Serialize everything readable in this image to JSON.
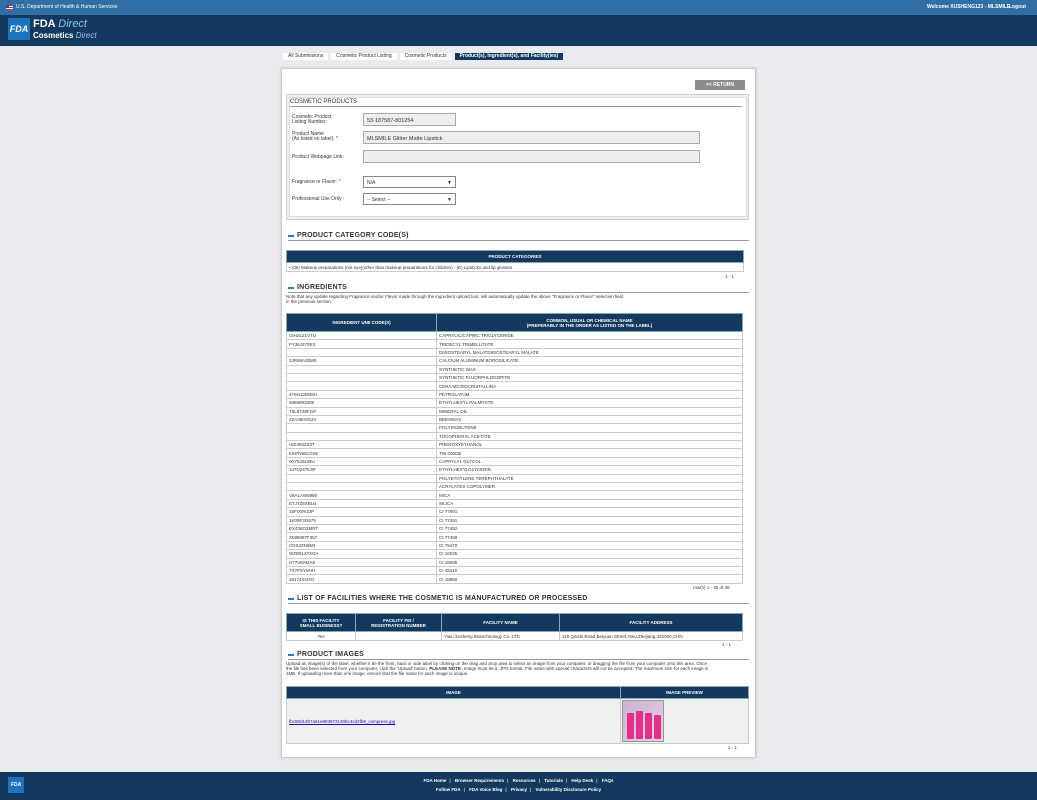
{
  "topbar": {
    "agency": "U.S. Department of Health & Human Services",
    "welcome": "Welcome XUSHENG123 - MLSMILE",
    "logout": "Logout"
  },
  "header": {
    "logo": "FDA",
    "brand_fda": "FDA",
    "brand_direct": "Direct",
    "brand_cosmetics": "Cosmetics",
    "brand_direct2": "Direct"
  },
  "breadcrumb": [
    "All Submissions",
    "Cosmetic Product Listing",
    "Cosmetic Products",
    "Product(s), Ingredient(s), and Facility(ies)"
  ],
  "return_button": "<< RETURN",
  "cosmetic_products": {
    "title": "COSMETIC PRODUCTS",
    "listing_label_1": "Cosmetic Product",
    "listing_label_2": "Listing Number:",
    "listing_value": "53-187587-801254",
    "name_label_1": "Product Name",
    "name_label_2": "(As listed on label):",
    "name_value": "MLSMILE Glitter Matte Lipstick",
    "webpage_label": "Product Webpage Link:",
    "webpage_value": "",
    "fragrance_label": "Fragrance or Flavor:",
    "fragrance_value": "N/A",
    "pro_label": "Professional Use Only :",
    "pro_value": "-- Select --",
    "required_mark": "*"
  },
  "category": {
    "title": "PRODUCT CATEGORY CODE(S)",
    "header": "PRODUCT CATEGORIES",
    "item": "(06) Makeup preparations (not eye)(other than makeup preparations for children) - (E) Lipsticks and lip glosses",
    "pager": "1 - 1"
  },
  "ingredients": {
    "title": "INGREDIENTS",
    "note_1": "Note that any update regarding Fragrance and/or Flavor made through the ingredient upload tool, will automatically update the above \"Fragrance or Flavor\" selection field",
    "note_2": "in the previous section.",
    "col1": "INGREDIENT UNII CODE(S)",
    "col2_1": "COMMON, USUAL OR CHEMICAL NAME",
    "col2_2": "(PREFERABLY IN THE ORDER AS LISTED ON THE LABEL)",
    "rows": [
      [
        "OIH2L21VTU",
        "CAPRYLIC/CAPRIC TRIGLYCERIDE"
      ],
      [
        "FY36J270ES",
        "TRIDECYL TRIMELLITATE"
      ],
      [
        "",
        "DIISOSTEARYL MALATDIISOSTEARYL MALATE"
      ],
      [
        "3JR68A35M0",
        "CALCIUM ALUMINUM BOROSILICATE"
      ],
      [
        "",
        "SYNTHETIC WAX"
      ],
      [
        "",
        "SYNTHETIC FLUORPHLOGOPITE"
      ],
      [
        "",
        "CERA MICROCRISTALLINA"
      ],
      [
        "4T6H12BN9U",
        "PETROLATUM"
      ],
      [
        "2865993309",
        "ETHYLHEXYL PALMITATE"
      ],
      [
        "T5L8T28FGP",
        "MINERAL OIL"
      ],
      [
        "2ZA36H0S2V",
        "BEESWAX"
      ],
      [
        "",
        "POLYISOBUTENE"
      ],
      [
        "",
        "TOCOPHERYL ACETATE"
      ],
      [
        "HIE492ZZ3T",
        "PHENOXYETHANOL"
      ],
      [
        "KM7N50LOS6",
        "TIN OXIDE"
      ],
      [
        "00YIU5438U",
        "CAPRYLYL GLYCOL"
      ],
      [
        "147D247K3P",
        "ETHYLHEXYLGLYCERIN"
      ],
      [
        "",
        "POLYETHYLENE TEREPHTHALATE"
      ],
      [
        "",
        "ACRYLATES COPOLYMER"
      ],
      [
        "V8A1AW0880",
        "MICA"
      ],
      [
        "ETJ7Z6XBU4",
        "SILICA"
      ],
      [
        "15FIX9V2JP",
        "CI 77891"
      ],
      [
        "1K09F3G675",
        "CI 77491"
      ],
      [
        "EX438O2MRT",
        "CI 77492"
      ],
      [
        "XM0M87F357",
        "CI 77499"
      ],
      [
        "CDS2ZN95N",
        "CI 75470"
      ],
      [
        "WZB9127XOA",
        "CI 16035"
      ],
      [
        "H77VEI93A8",
        "CI 15985"
      ],
      [
        "7X7PSY5NH",
        "CI 45410"
      ],
      [
        "481744AI4O",
        "CI 15850"
      ]
    ],
    "pager": "row(s) 1 - 30 of 30"
  },
  "facilities": {
    "title": "LIST OF FACILITIES WHERE THE COSMETIC IS MANUFACTURED OR PROCESSED",
    "col1_1": "IS THIS FACILITY",
    "col1_2": "SMALL BUSINESS?",
    "col2_1": "FACILITY FEI /",
    "col2_2": "REGISTRATION NUMBER",
    "col3": "FACILITY NAME",
    "col4": "FACILITY ADDRESS",
    "row": {
      "small": "Yes",
      "fei": "",
      "name": "Yiwu Xusheng Biotechnology Co.,LTD",
      "address": "115 Qiushi Road,Beiyuan Street,Yiwu,Zhejiang,322000,CHN"
    },
    "pager": "1 - 1"
  },
  "images": {
    "title": "PRODUCT IMAGES",
    "note_1": "Upload an image(s) of the label, whether it be the front, back or side label by clicking on the drag and drop area to select an image from your computer, or dragging the file from your computer onto this area. Once",
    "note_2a": "the file has been selected from your computer, click the 'Upload' button. ",
    "note_2b": "PLEASE NOTE:",
    "note_2c": " Image must be a .JPG format. File name with special characters will not be accepted. The maximum size for each image is",
    "note_3": "1MB. If uploading more than one image, ensure that the file name for each image is unique.",
    "col1": "IMAGE",
    "col2": "IMAGE PREVIEW",
    "file": "fbc80d12b7a61e883973130bc4cd2fb8_compress.jpg",
    "pager": "1 - 1"
  },
  "footer": {
    "logo": "FDA",
    "row1": [
      "FDA Home",
      "Browser Requirements",
      "Resources",
      "Tutorials",
      "Help Desk",
      "FAQs"
    ],
    "row2": [
      "Follow FDA",
      "FDA Voice Blog",
      "Privacy",
      "Vulnerability Disclosure Policy"
    ],
    "sep": "|"
  }
}
